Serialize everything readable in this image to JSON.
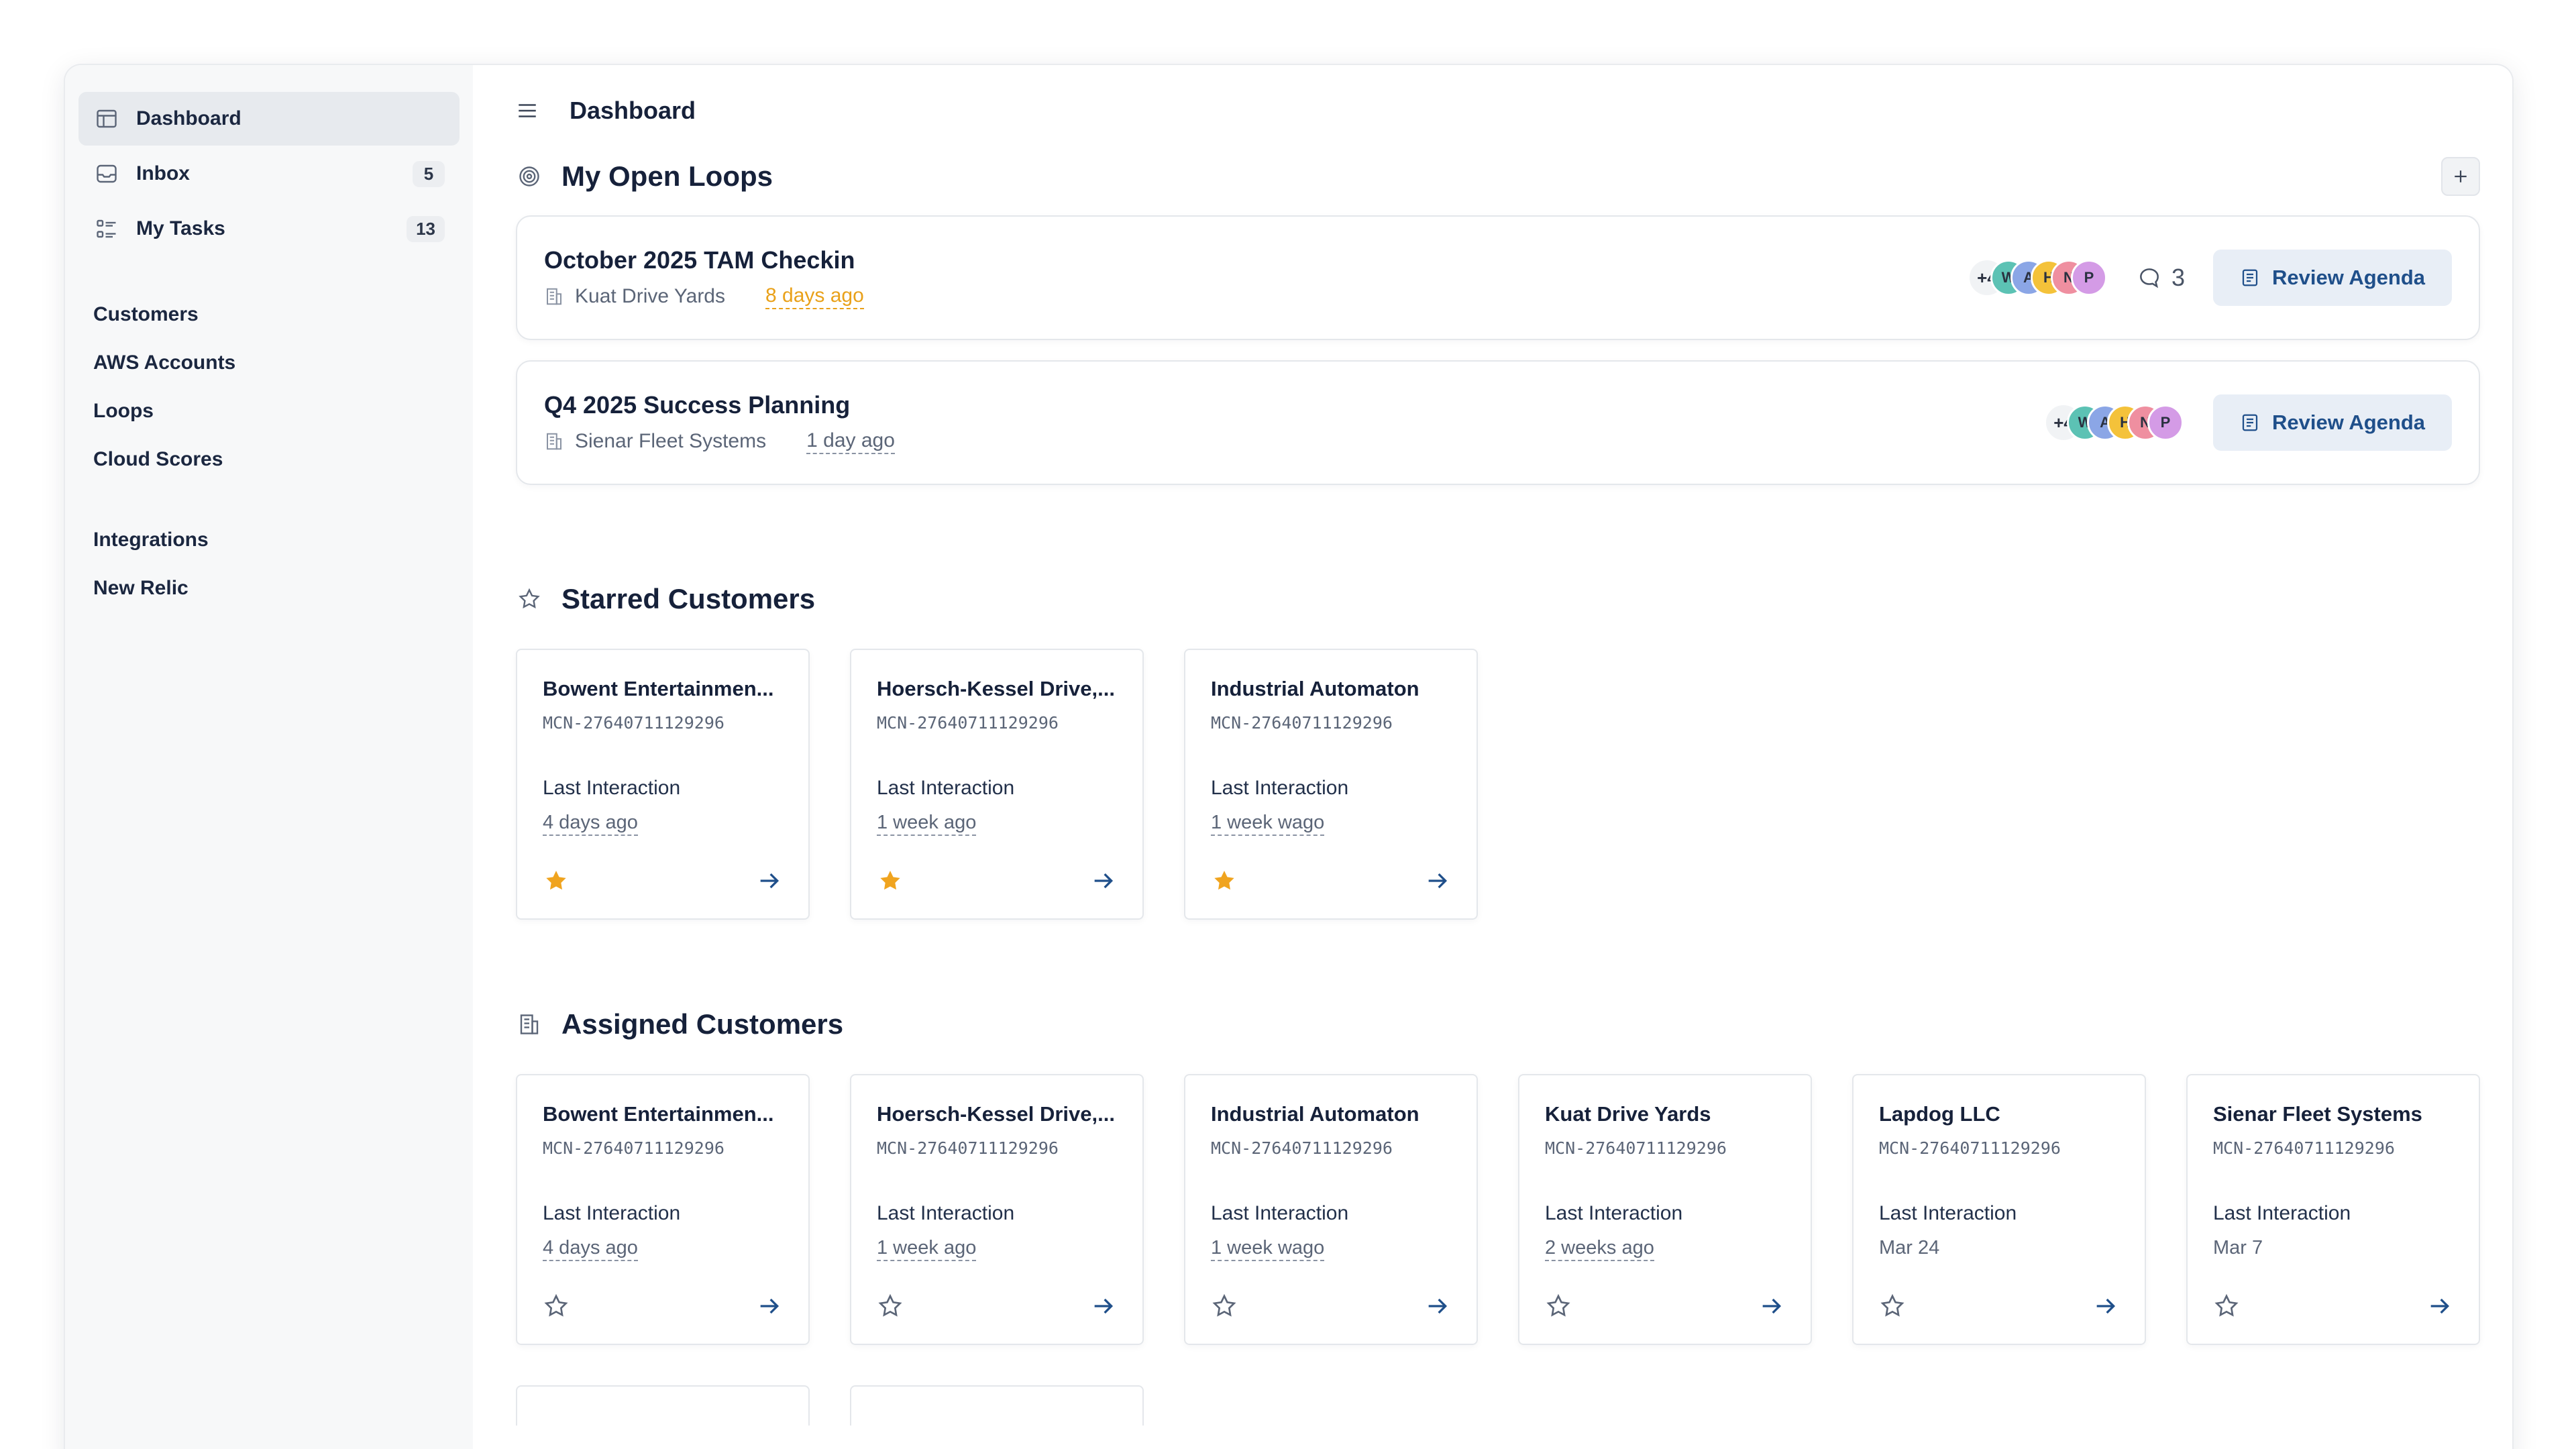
{
  "sidebar": {
    "items": [
      {
        "label": "Dashboard",
        "icon": "layout-icon",
        "active": true
      },
      {
        "label": "Inbox",
        "icon": "inbox-icon",
        "count": "5"
      },
      {
        "label": "My Tasks",
        "icon": "tasks-icon",
        "count": "13"
      }
    ],
    "group1": [
      "Customers",
      "AWS Accounts",
      "Loops",
      "Cloud Scores"
    ],
    "group2": [
      "Integrations",
      "New Relic"
    ]
  },
  "header": {
    "title": "Dashboard"
  },
  "open_loops": {
    "title": "My Open Loops",
    "items": [
      {
        "title": "October 2025 TAM Checkin",
        "company": "Kuat Drive Yards",
        "date": "8 days ago",
        "more": "+4",
        "avatars": [
          "W",
          "A",
          "H",
          "N",
          "P"
        ],
        "comments": "3",
        "button": "Review Agenda"
      },
      {
        "title": "Q4 2025 Success Planning",
        "company": "Sienar Fleet Systems",
        "date": "1 day ago",
        "more": "+4",
        "avatars": [
          "W",
          "A",
          "H",
          "N",
          "P"
        ],
        "button": "Review Agenda"
      }
    ]
  },
  "starred": {
    "title": "Starred Customers",
    "items": [
      {
        "name": "Bowent Entertainmen...",
        "id": "MCN-27640711129296",
        "label": "Last Interaction",
        "value": "4 days ago"
      },
      {
        "name": "Hoersch-Kessel Drive,...",
        "id": "MCN-27640711129296",
        "label": "Last Interaction",
        "value": "1 week ago"
      },
      {
        "name": "Industrial Automaton",
        "id": "MCN-27640711129296",
        "label": "Last Interaction",
        "value": "1 week wago"
      }
    ]
  },
  "assigned": {
    "title": "Assigned Customers",
    "items": [
      {
        "name": "Bowent Entertainmen...",
        "id": "MCN-27640711129296",
        "label": "Last Interaction",
        "value": "4 days ago"
      },
      {
        "name": "Hoersch-Kessel Drive,...",
        "id": "MCN-27640711129296",
        "label": "Last Interaction",
        "value": "1 week ago"
      },
      {
        "name": "Industrial Automaton",
        "id": "MCN-27640711129296",
        "label": "Last Interaction",
        "value": "1 week wago"
      },
      {
        "name": "Kuat Drive Yards",
        "id": "MCN-27640711129296",
        "label": "Last Interaction",
        "value": "2 weeks ago"
      },
      {
        "name": "Lapdog LLC",
        "id": "MCN-27640711129296",
        "label": "Last Interaction",
        "value": "Mar 24"
      },
      {
        "name": "Sienar Fleet Systems",
        "id": "MCN-27640711129296",
        "label": "Last Interaction",
        "value": "Mar 7"
      }
    ]
  },
  "colors": {
    "accent": "#1f4f8a",
    "star": "#f0a41f",
    "warn": "#e9a11a",
    "avatars": [
      "#5cc2b4",
      "#8ba6e6",
      "#f4c23a",
      "#ef8fa0",
      "#d49be6"
    ]
  }
}
